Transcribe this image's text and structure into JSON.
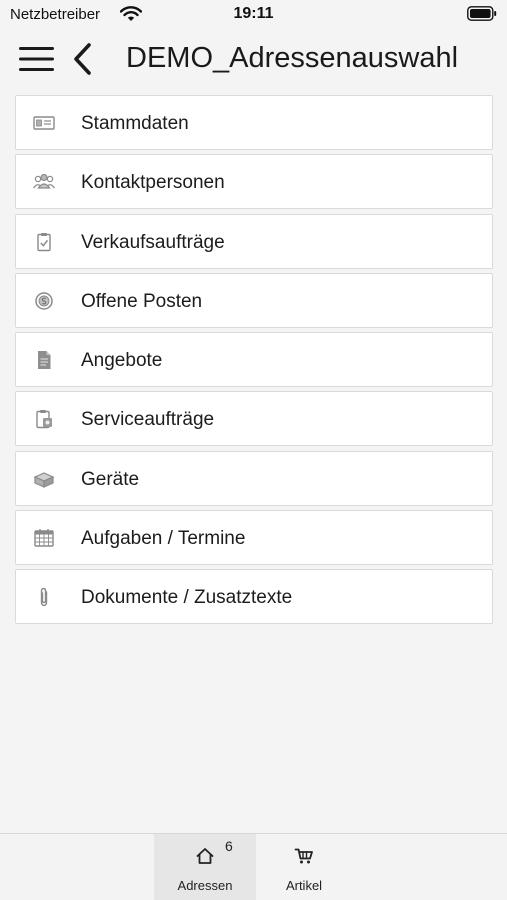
{
  "status_bar": {
    "carrier": "Netzbetreiber",
    "time": "19:11",
    "wifi_icon": "wifi-icon",
    "battery_icon": "battery-icon"
  },
  "header": {
    "menu_icon": "hamburger-menu-icon",
    "back_icon": "chevron-left-icon",
    "title": "DEMO_Adressenauswahl"
  },
  "menu": {
    "items": [
      {
        "label": "Stammdaten",
        "icon": "id-card-icon"
      },
      {
        "label": "Kontaktpersonen",
        "icon": "people-group-icon"
      },
      {
        "label": "Verkaufsaufträge",
        "icon": "clipboard-check-icon"
      },
      {
        "label": "Offene Posten",
        "icon": "coin-icon"
      },
      {
        "label": "Angebote",
        "icon": "document-icon"
      },
      {
        "label": "Serviceaufträge",
        "icon": "service-clipboard-icon"
      },
      {
        "label": "Geräte",
        "icon": "device-box-icon"
      },
      {
        "label": "Aufgaben / Termine",
        "icon": "calendar-icon"
      },
      {
        "label": "Dokumente / Zusatztexte",
        "icon": "paperclip-icon"
      }
    ]
  },
  "tab_bar": {
    "tabs": [
      {
        "label": "Adressen",
        "icon": "home-icon",
        "badge": "6",
        "selected": true
      },
      {
        "label": "Artikel",
        "icon": "cart-icon",
        "selected": false
      }
    ]
  },
  "colors": {
    "background": "#f4f4f4",
    "card": "#ffffff",
    "border": "#dadada",
    "icon": "#8a8a8a",
    "tab_selected": "#e6e6e6"
  }
}
